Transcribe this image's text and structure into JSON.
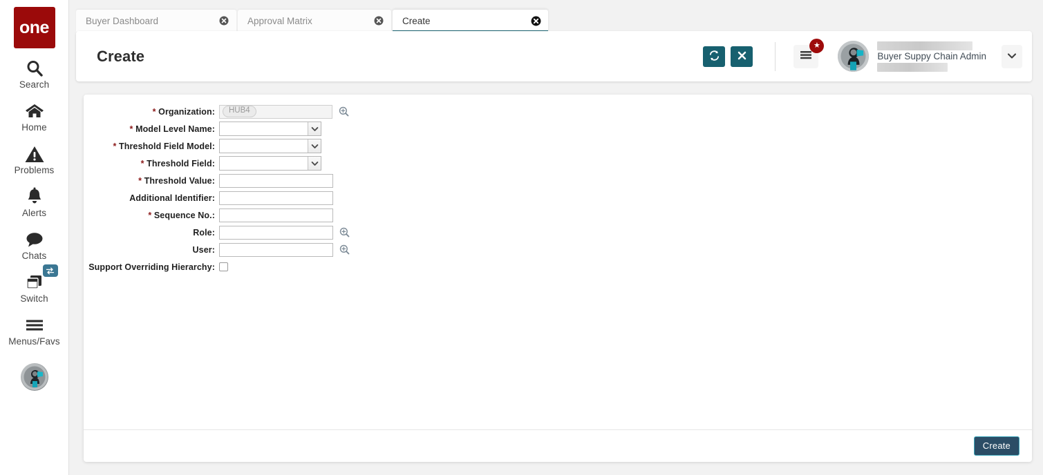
{
  "brand": {
    "logo_text": "one",
    "logo_color": "#9b0a0a"
  },
  "sidebar": {
    "items": [
      {
        "label": "Search",
        "icon": "search-icon"
      },
      {
        "label": "Home",
        "icon": "home-icon"
      },
      {
        "label": "Problems",
        "icon": "warning-triangle-icon"
      },
      {
        "label": "Alerts",
        "icon": "bell-icon"
      },
      {
        "label": "Chats",
        "icon": "chat-bubble-icon"
      },
      {
        "label": "Switch",
        "icon": "windows-stack-icon",
        "badge_icon": "exchange-arrows-icon"
      },
      {
        "label": "Menus/Favs",
        "icon": "hamburger-icon"
      }
    ],
    "avatar_icon": "user-avatar-icon"
  },
  "tabs": [
    {
      "label": "Buyer Dashboard",
      "active": false,
      "close_icon": "close-circle-icon"
    },
    {
      "label": "Approval Matrix",
      "active": false,
      "close_icon": "close-circle-icon"
    },
    {
      "label": "Create",
      "active": true,
      "close_icon": "close-circle-icon"
    }
  ],
  "header": {
    "title": "Create",
    "refresh_icon": "refresh-icon",
    "close_icon": "close-x-icon",
    "menu_icon": "hamburger-icon",
    "menu_badge_icon": "star-icon",
    "menu_badge_color": "#9e0b0b",
    "avatar_icon": "user-avatar-icon",
    "user_name": "Buyer Suppy Chain Admin",
    "dropdown_icon": "chevron-down-icon",
    "accent_color": "#17606f"
  },
  "form": {
    "fields": [
      {
        "label": "Organization",
        "required": true,
        "type": "lookup-token",
        "value": "HUB4",
        "disabled": true,
        "lookup_icon": "magnifier-plus-icon"
      },
      {
        "label": "Model Level Name",
        "required": true,
        "type": "select",
        "value": "",
        "options": [
          ""
        ],
        "dropdown_icon": "chevron-down-icon"
      },
      {
        "label": "Threshold Field Model",
        "required": true,
        "type": "select",
        "value": "",
        "options": [
          ""
        ],
        "dropdown_icon": "chevron-down-icon"
      },
      {
        "label": "Threshold Field",
        "required": true,
        "type": "select",
        "value": "",
        "options": [
          ""
        ],
        "dropdown_icon": "chevron-down-icon"
      },
      {
        "label": "Threshold Value",
        "required": true,
        "type": "text",
        "value": "",
        "placeholder": ""
      },
      {
        "label": "Additional Identifier",
        "required": false,
        "type": "text",
        "value": "",
        "placeholder": ""
      },
      {
        "label": "Sequence No.",
        "required": true,
        "type": "text",
        "value": "",
        "placeholder": ""
      },
      {
        "label": "Role",
        "required": false,
        "type": "lookup",
        "value": "",
        "placeholder": "",
        "lookup_icon": "magnifier-plus-icon"
      },
      {
        "label": "User",
        "required": false,
        "type": "lookup",
        "value": "",
        "placeholder": "",
        "lookup_icon": "magnifier-plus-icon"
      },
      {
        "label": "Support Overriding Hierarchy",
        "required": false,
        "type": "checkbox",
        "checked": false
      }
    ],
    "submit_label": "Create",
    "submit_bg": "#2b4d66",
    "submit_border": "#3fa9bd"
  }
}
